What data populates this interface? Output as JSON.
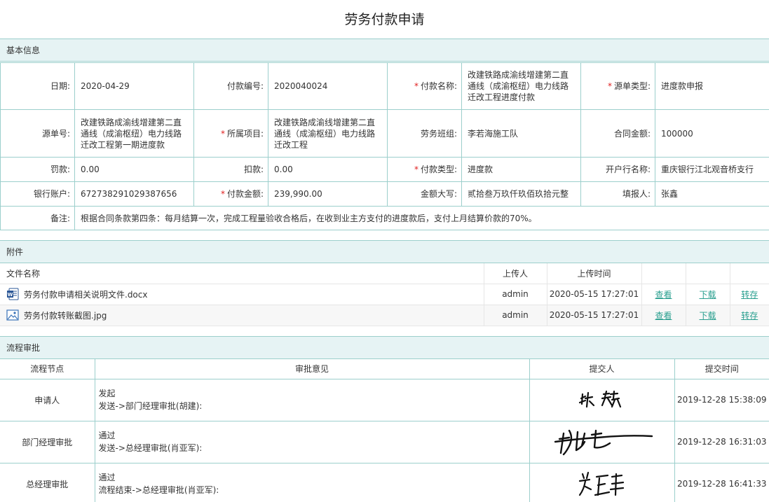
{
  "page": {
    "title": "劳务付款申请"
  },
  "sections": {
    "basic": "基本信息",
    "attachments": "附件",
    "flow": "流程审批"
  },
  "basic": {
    "date_label": "日期:",
    "date": "2020-04-29",
    "pay_no_label": "付款编号:",
    "pay_no": "2020040024",
    "pay_name_label": "付款名称:",
    "pay_name": "改建铁路成渝线增建第二直通线（成渝枢纽）电力线路迁改工程进度付款",
    "src_type_label": "源单类型:",
    "src_type": "进度款申报",
    "src_no_label": "源单号:",
    "src_no": "改建铁路成渝线增建第二直通线（成渝枢纽）电力线路迁改工程第一期进度款",
    "project_label": "所属项目:",
    "project": "改建铁路成渝线增建第二直通线（成渝枢纽）电力线路迁改工程",
    "team_label": "劳务班组:",
    "team": "李若海施工队",
    "contract_amt_label": "合同金额:",
    "contract_amt": "100000",
    "fine_label": "罚款:",
    "fine": "0.00",
    "deduct_label": "扣款:",
    "deduct": "0.00",
    "pay_type_label": "付款类型:",
    "pay_type": "进度款",
    "bank_label": "开户行名称:",
    "bank": "重庆银行江北观音桥支行",
    "account_label": "银行账户:",
    "account": "672738291029387656",
    "amount_label": "付款金额:",
    "amount": "239,990.00",
    "amount_cn_label": "金额大写:",
    "amount_cn": "贰拾叁万玖仟玖佰玖拾元整",
    "filler_label": "填报人:",
    "filler": "张鑫",
    "remark_label": "备注:",
    "remark": "根据合同条款第四条：每月结算一次，完成工程量验收合格后，在收到业主方支付的进度款后，支付上月结算价款的70%。"
  },
  "attachments": {
    "headers": {
      "name": "文件名称",
      "uploader": "上传人",
      "time": "上传时间"
    },
    "actions": {
      "view": "查看",
      "download": "下载",
      "save": "转存"
    },
    "files": [
      {
        "name": "劳务付款申请相关说明文件.docx",
        "icon": "word-doc-icon",
        "uploader": "admin",
        "time": "2020-05-15 17:27:01"
      },
      {
        "name": "劳务付款转账截图.jpg",
        "icon": "image-file-icon",
        "uploader": "admin",
        "time": "2020-05-15 17:27:01"
      }
    ]
  },
  "flow": {
    "headers": {
      "node": "流程节点",
      "opinion": "审批意见",
      "submitter": "提交人",
      "time": "提交时间"
    },
    "rows": [
      {
        "node": "申请人",
        "action": "发起",
        "next": "发送->部门经理审批(胡建):",
        "signature": "张鑫",
        "time": "2019-12-28 15:38:09"
      },
      {
        "node": "部门经理审批",
        "action": "通过",
        "next": "发送->总经理审批(肖亚军):",
        "signature": "胡建",
        "time": "2019-12-28 16:31:03"
      },
      {
        "node": "总经理审批",
        "action": "通过",
        "next": "流程结束->总经理审批(肖亚军):",
        "signature": "肖亚军",
        "time": "2019-12-28 16:41:33"
      }
    ]
  },
  "colors": {
    "accent": "#2a9f8f",
    "header_bg": "#e6f3f4",
    "border": "#9ccfcc",
    "required": "#e02020"
  }
}
